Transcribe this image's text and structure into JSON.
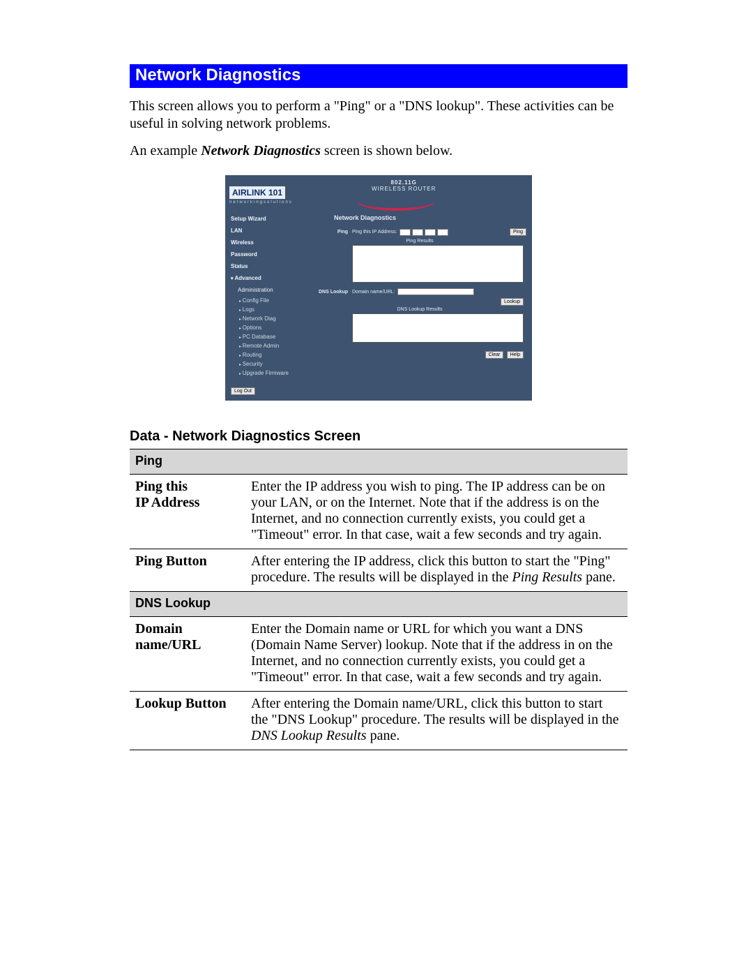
{
  "title": "Network Diagnostics",
  "intro_p1": "This screen allows you to perform a \"Ping\" or a \"DNS lookup\". These activities can be useful in solving network problems.",
  "intro_p2_a": "An example ",
  "intro_p2_b": "Network Diagnostics",
  "intro_p2_c": " screen is shown below.",
  "screenshot": {
    "logo_text": "AIRLINK 101",
    "logo_sub": "networkingsolutions",
    "brand_line1": "802.11G",
    "brand_line2": "WIRELESS ROUTER",
    "nav": {
      "items": [
        "Setup Wizard",
        "LAN",
        "Wireless",
        "Password",
        "Status"
      ],
      "advanced_label": "Advanced",
      "advanced_sub_header": "Administration",
      "subs": [
        "Config File",
        "Logs",
        "Network Diag",
        "Options",
        "PC Database",
        "Remote Admin",
        "Routing",
        "Security",
        "Upgrade Firmware"
      ]
    },
    "logout": "Log Out",
    "main_title": "Network Diagnostics",
    "ping": {
      "section": "Ping",
      "field": "Ping this IP Address:",
      "button": "Ping",
      "results": "Ping Results"
    },
    "dns": {
      "section": "DNS Lookup",
      "field": "Domain name/URL:",
      "button": "Lookup",
      "results": "DNS Lookup Results"
    },
    "clear": "Clear",
    "help": "Help"
  },
  "section_heading": "Data - Network Diagnostics Screen",
  "table": {
    "group1": "Ping",
    "r1": {
      "label_a": "Ping this",
      "label_b": "IP Address",
      "text": "Enter the IP address you wish to ping. The IP address can be on your LAN, or on the Internet. Note that if the address is on the Internet, and no connection currently exists, you could get a \"Timeout\" error. In that case, wait a few seconds and try again."
    },
    "r2": {
      "label": "Ping Button",
      "text_a": "After entering the IP address, click this button to start the \"Ping\" procedure. The results will be displayed in the ",
      "text_b": "Ping Results",
      "text_c": " pane."
    },
    "group2": "DNS Lookup",
    "r3": {
      "label_a": "Domain",
      "label_b": "name/URL",
      "text": "Enter the Domain name or URL for which you want a DNS (Domain Name Server) lookup. Note that if the address in on the Internet, and no connection currently exists, you could get a \"Timeout\" error. In that case, wait a few seconds and try again."
    },
    "r4": {
      "label": "Lookup Button",
      "text_a": "After entering the Domain name/URL, click this button to start the \"DNS Lookup\" procedure. The results will be displayed in the ",
      "text_b": "DNS Lookup Results",
      "text_c": " pane."
    }
  }
}
